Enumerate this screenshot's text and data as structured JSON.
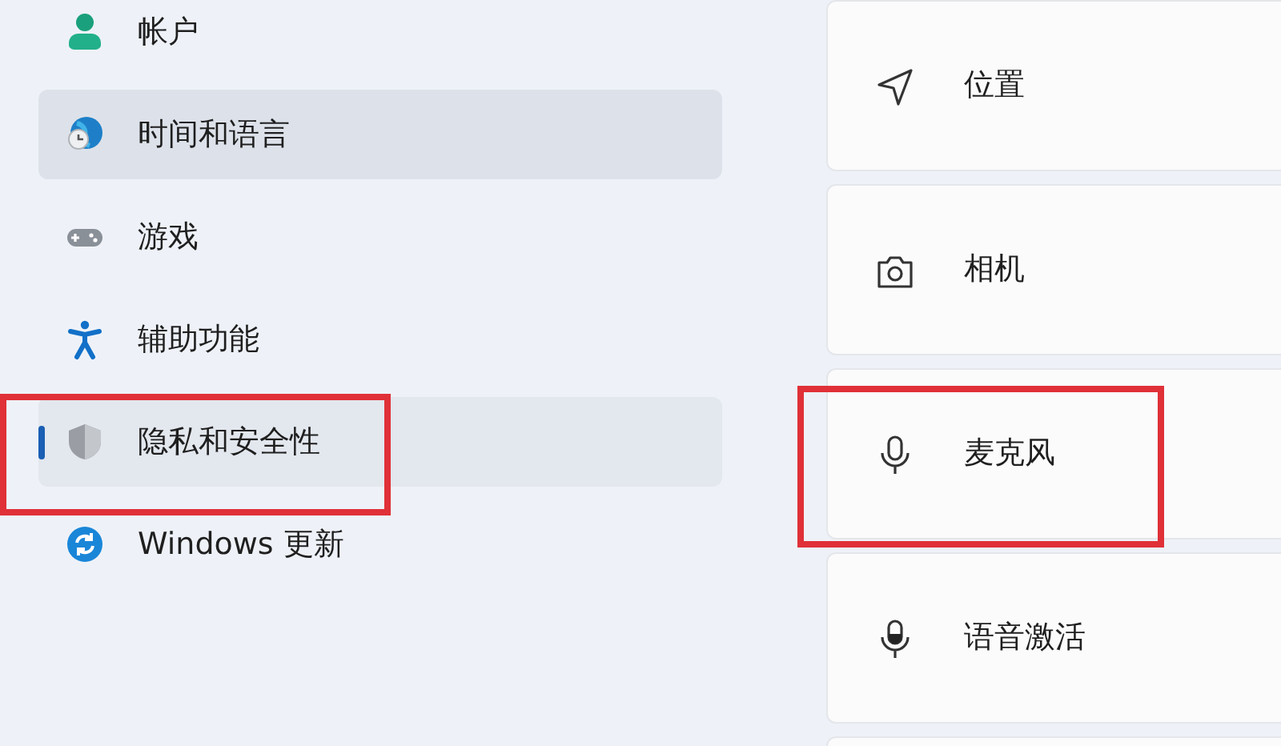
{
  "sidebar": {
    "items": [
      {
        "label": "帐户",
        "kind": "person",
        "selected": false,
        "hovered": false,
        "annotated": false
      },
      {
        "label": "时间和语言",
        "kind": "globe-clock",
        "selected": false,
        "hovered": true,
        "annotated": false
      },
      {
        "label": "游戏",
        "kind": "gamepad",
        "selected": false,
        "hovered": false,
        "annotated": false
      },
      {
        "label": "辅助功能",
        "kind": "accessibility",
        "selected": false,
        "hovered": false,
        "annotated": false
      },
      {
        "label": "隐私和安全性",
        "kind": "shield",
        "selected": true,
        "hovered": false,
        "annotated": true
      },
      {
        "label": "Windows 更新",
        "kind": "update",
        "selected": false,
        "hovered": false,
        "annotated": false
      }
    ]
  },
  "permissions": [
    {
      "label": "位置",
      "kind": "location",
      "annotated": false
    },
    {
      "label": "相机",
      "kind": "camera",
      "annotated": false
    },
    {
      "label": "麦克风",
      "kind": "mic",
      "annotated": true
    },
    {
      "label": "语音激活",
      "kind": "mic-filled",
      "annotated": false
    }
  ]
}
